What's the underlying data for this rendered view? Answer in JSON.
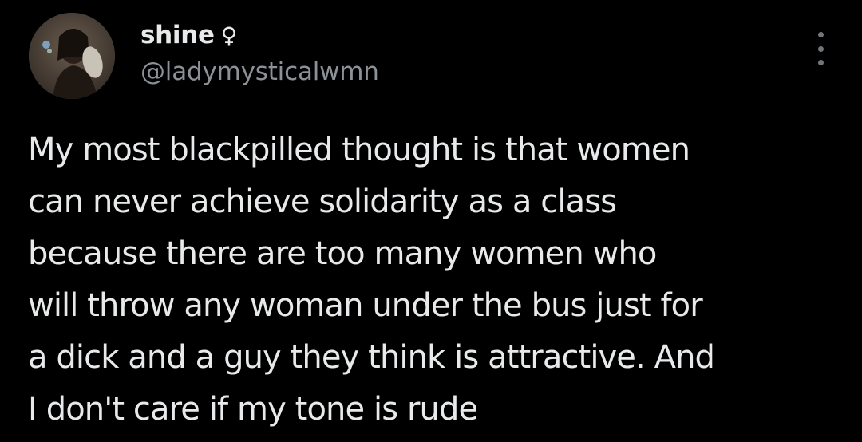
{
  "author": {
    "display_name": "shine",
    "name_emoji": "♀",
    "handle": "@ladymysticalwmn",
    "avatar_icon": "profile-photo"
  },
  "more_menu_icon": "more-vertical-icon",
  "tweet": {
    "lines": [
      "My most blackpilled thought is that women",
      "can never achieve solidarity as a class",
      "because there are too many women who",
      "will throw any woman under the bus just for",
      "a dick and a guy they think is attractive. And",
      "I don't care if my tone is rude"
    ]
  },
  "colors": {
    "background": "#000000",
    "primary_text": "#e7e9ea",
    "secondary_text": "#8b9197",
    "icon": "#71767b"
  }
}
